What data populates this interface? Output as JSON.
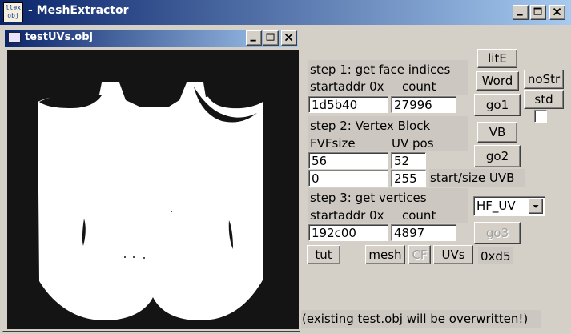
{
  "app": {
    "title": "- MeshExtractor",
    "icon_text_line1": "ll⊗x",
    "icon_text_line2": "obj"
  },
  "child_window": {
    "title": "testUVs.obj"
  },
  "step1": {
    "heading": "step 1: get face indices",
    "addr_label": "startaddr 0x",
    "count_label": "count",
    "addr_value": "1d5b40",
    "count_value": "27996"
  },
  "step2": {
    "heading": "step 2: Vertex Block",
    "fvf_label": "FVFsize",
    "uvpos_label": "UV pos",
    "fvf_value": "56",
    "uvpos_value": "52",
    "start_value": "0",
    "size_value": "255",
    "startsize_label": "start/size UVB"
  },
  "step3": {
    "heading": "step 3: get vertices",
    "addr_label": "startaddr 0x",
    "count_label": "count",
    "addr_value": "192c00",
    "count_value": "4897"
  },
  "buttons": {
    "lite": "litE",
    "word": "Word",
    "nostr": "noStr",
    "go1": "go1",
    "std": "std",
    "vb": "VB",
    "go2": "go2",
    "go3": "go3",
    "tut": "tut",
    "mesh": "mesh",
    "cf": "CF",
    "uvs": "UVs"
  },
  "format_dropdown": {
    "selected": "HF_UV"
  },
  "status": {
    "hex_value": "0xd5",
    "note": "(existing test.obj will be overwritten!)"
  },
  "colors": {
    "titlebar_start": "#0a246a",
    "titlebar_end": "#a6caf0",
    "window_face": "#d4d0c8",
    "viewport_bg": "#141414",
    "uv_fill": "#ffffff"
  }
}
